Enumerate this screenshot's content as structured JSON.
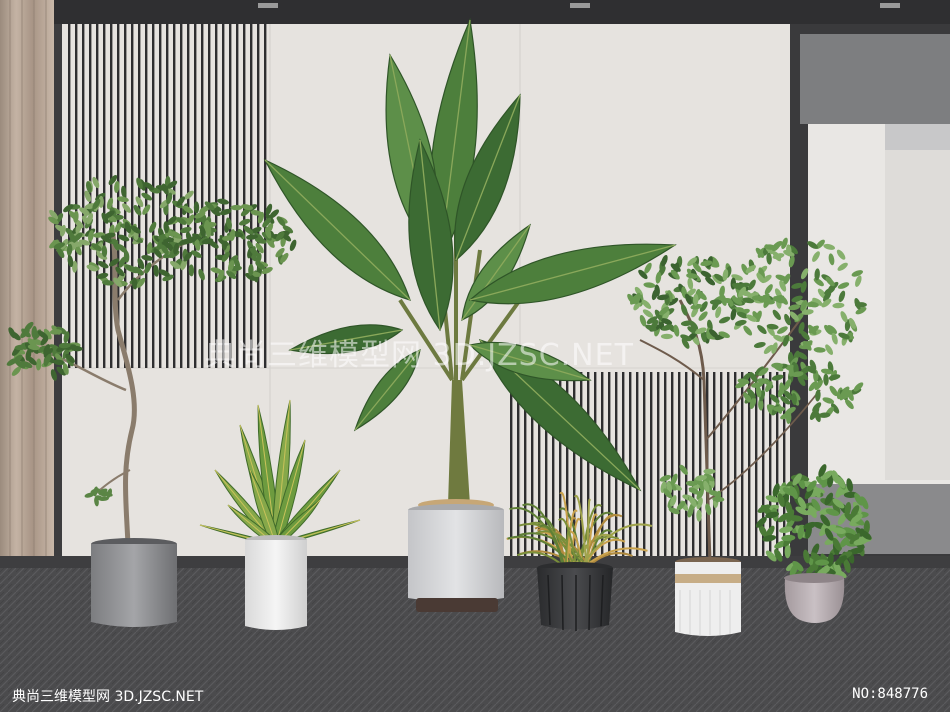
{
  "watermark": {
    "center_text": "典尚三维模型网 3D.JZSC.NET",
    "footer_left": "典尚三维模型网 3D.JZSC.NET",
    "footer_right": "NO:848776"
  },
  "scene": {
    "plants": [
      {
        "name": "tree-in-gray-pot"
      },
      {
        "name": "snake-plant-in-white-pot"
      },
      {
        "name": "banana-plant-in-gray-pot"
      },
      {
        "name": "grass-in-black-pot"
      },
      {
        "name": "maple-in-striped-pot"
      },
      {
        "name": "shrub-in-mauve-pot"
      }
    ]
  },
  "colors": {
    "wall": "#e6e3df",
    "floor": "#4a4a4c",
    "frame": "#3d3d3f",
    "leaf_dark": "#3c6b33",
    "leaf_light": "#5d8f49"
  }
}
